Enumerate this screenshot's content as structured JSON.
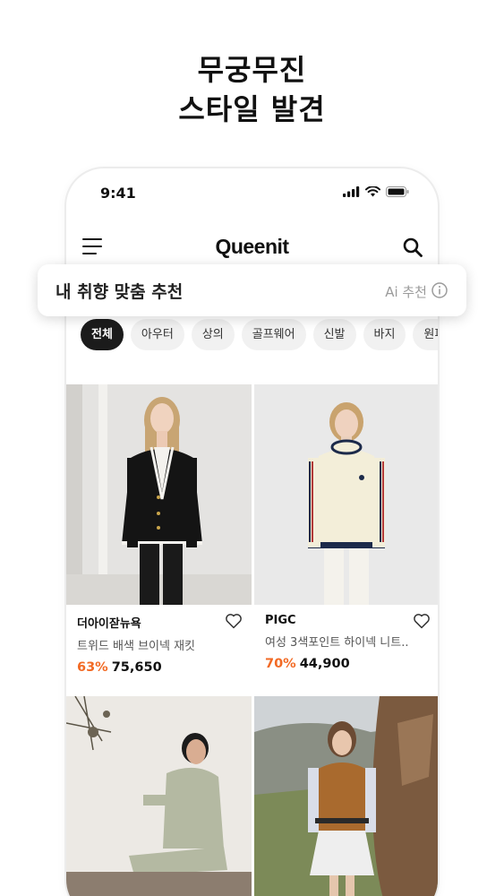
{
  "headline": {
    "line1": "무궁무진",
    "line2": "스타일 발견"
  },
  "status_bar": {
    "time": "9:41"
  },
  "app_bar": {
    "logo": "Queenit"
  },
  "recommend_banner": {
    "title": "내 취향 맞춤 추천",
    "ai_label": "Ai 추천"
  },
  "category_tabs": [
    {
      "label": "전체",
      "active": true
    },
    {
      "label": "아우터",
      "active": false
    },
    {
      "label": "상의",
      "active": false
    },
    {
      "label": "골프웨어",
      "active": false
    },
    {
      "label": "신발",
      "active": false
    },
    {
      "label": "바지",
      "active": false
    },
    {
      "label": "원피스",
      "active": false
    }
  ],
  "products": [
    {
      "brand": "더아이잗뉴욕",
      "name": "트위드 배색 브이넥 재킷",
      "discount": "63%",
      "price": "75,650"
    },
    {
      "brand": "PIGC",
      "name": "여성 3색포인트 하이넥 니트..",
      "discount": "70%",
      "price": "44,900"
    },
    {
      "brand": "",
      "name": "",
      "discount": "",
      "price": ""
    },
    {
      "brand": "",
      "name": "",
      "discount": "",
      "price": ""
    }
  ],
  "colors": {
    "accent_discount": "#f26a24",
    "active_tab": "#1b1b1b"
  },
  "icons": [
    "signal-icon",
    "wifi-icon",
    "battery-icon",
    "menu-icon",
    "search-icon",
    "heart-icon",
    "info-icon"
  ]
}
